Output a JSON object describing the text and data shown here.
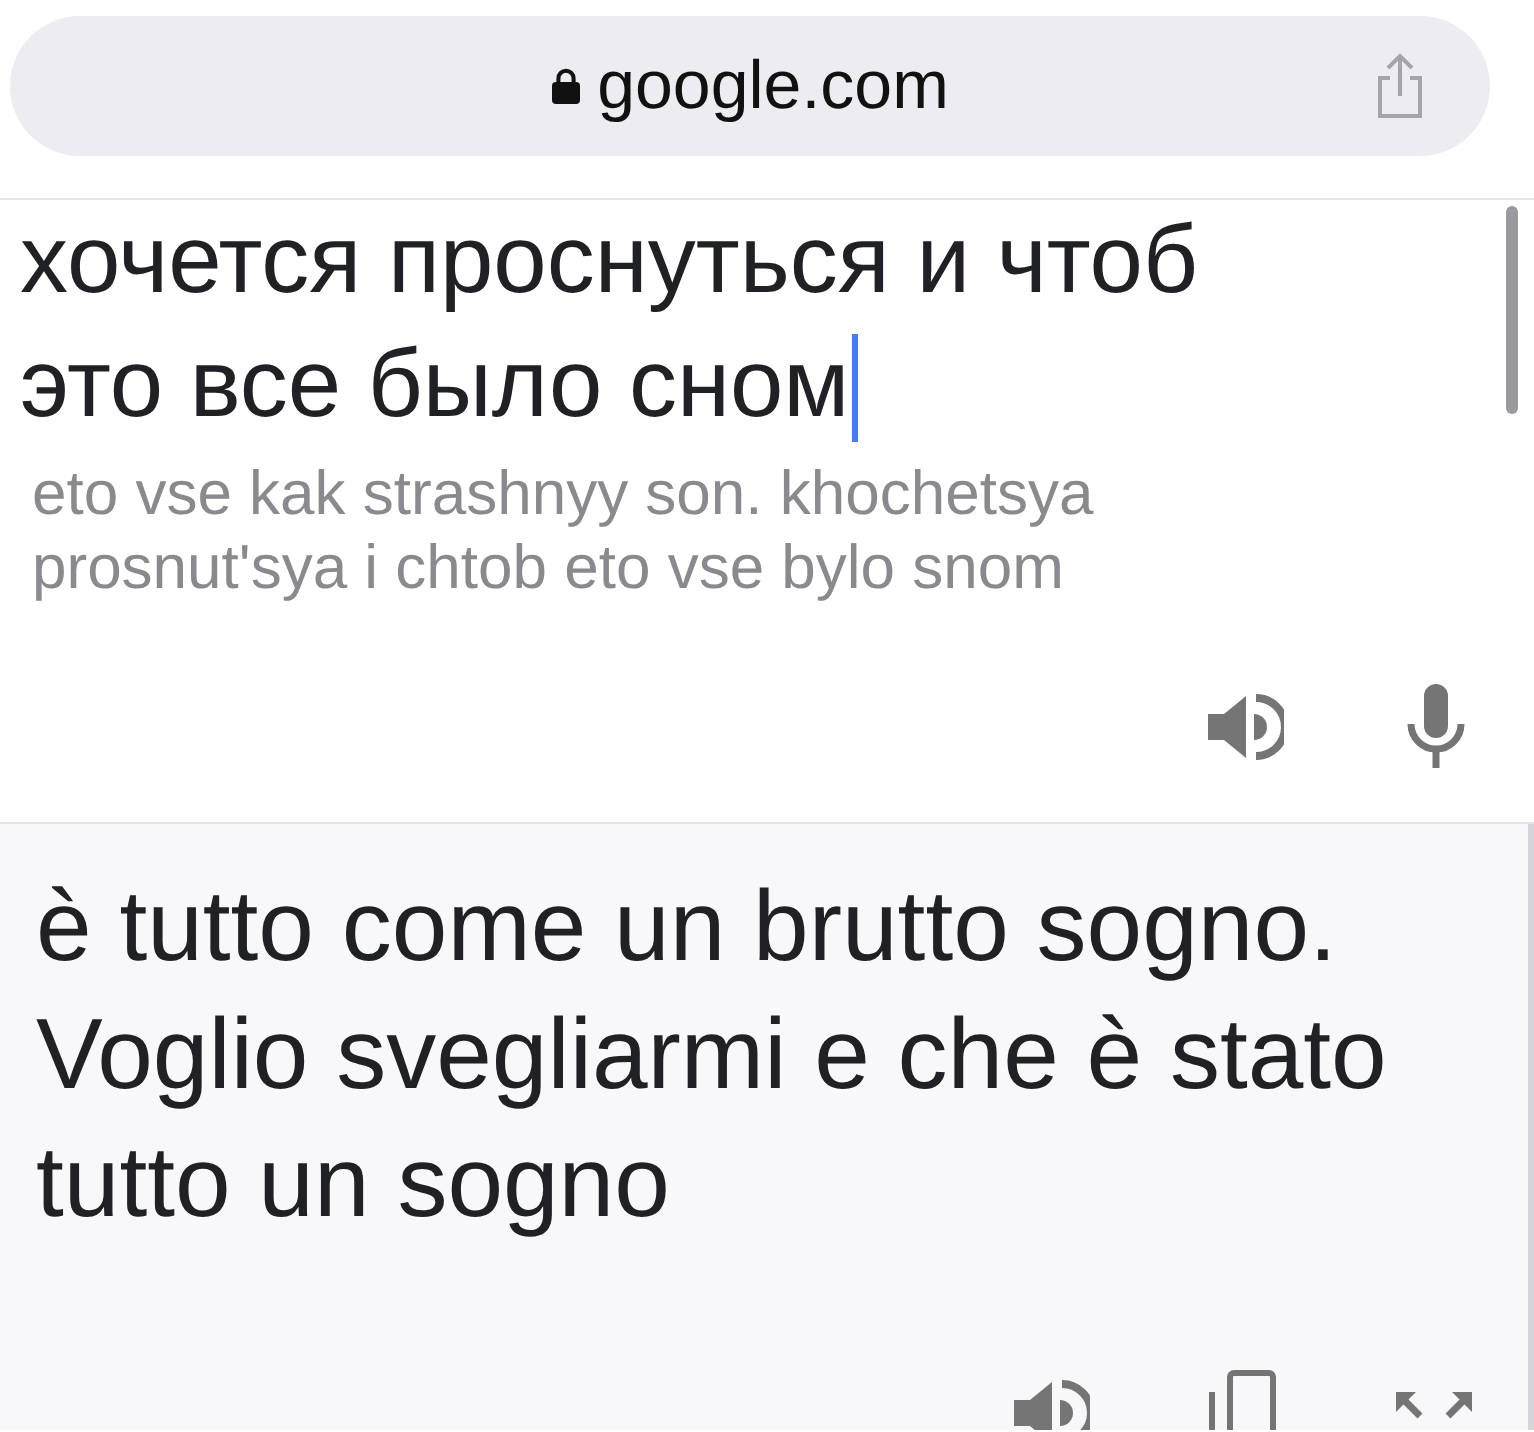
{
  "address_bar": {
    "url": "google.com",
    "secure": true
  },
  "source": {
    "text": "хочется проснуться и чтоб это все было сном",
    "focused": true,
    "transliteration": "eto vse kak strashnyy son. khochetsya prosnut'sya i chtob eto vse bylo snom"
  },
  "translation": {
    "text": "è tutto come un brutto sogno. Voglio svegliarmi e che è stato tutto un sogno"
  }
}
